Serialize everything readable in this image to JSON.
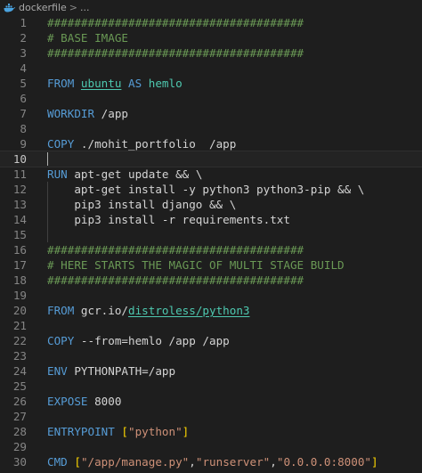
{
  "breadcrumb": {
    "file": "dockerfile",
    "separator": ">",
    "more": "...",
    "file_icon": "docker-whale-icon"
  },
  "editor": {
    "active_line": 10,
    "lines": [
      [
        {
          "t": "######################################",
          "c": "comment"
        }
      ],
      [
        {
          "t": "# BASE IMAGE",
          "c": "comment"
        }
      ],
      [
        {
          "t": "######################################",
          "c": "comment"
        }
      ],
      [],
      [
        {
          "t": "FROM ",
          "c": "keyword"
        },
        {
          "t": "ubuntu",
          "c": "image"
        },
        {
          "t": " AS ",
          "c": "keyword"
        },
        {
          "t": "hemlo",
          "c": "image-plain"
        }
      ],
      [],
      [
        {
          "t": "WORKDIR ",
          "c": "keyword"
        },
        {
          "t": "/app",
          "c": "plain"
        }
      ],
      [],
      [
        {
          "t": "COPY ",
          "c": "keyword"
        },
        {
          "t": "./mohit_portfolio  /app",
          "c": "plain"
        }
      ],
      [],
      [
        {
          "t": "RUN ",
          "c": "keyword"
        },
        {
          "t": "apt-get update && \\",
          "c": "plain"
        }
      ],
      [
        {
          "t": "    apt-get install -y python3 python3-pip && \\",
          "c": "plain"
        }
      ],
      [
        {
          "t": "    pip3 install django && \\",
          "c": "plain"
        }
      ],
      [
        {
          "t": "    pip3 install -r requirements.txt",
          "c": "plain"
        }
      ],
      [],
      [
        {
          "t": "######################################",
          "c": "comment"
        }
      ],
      [
        {
          "t": "# HERE STARTS THE MAGIC OF MULTI STAGE BUILD",
          "c": "comment"
        }
      ],
      [
        {
          "t": "######################################",
          "c": "comment"
        }
      ],
      [],
      [
        {
          "t": "FROM ",
          "c": "keyword"
        },
        {
          "t": "gcr.io/",
          "c": "plain"
        },
        {
          "t": "distroless/python3",
          "c": "image"
        }
      ],
      [],
      [
        {
          "t": "COPY ",
          "c": "keyword"
        },
        {
          "t": "--from=hemlo /app /app",
          "c": "plain"
        }
      ],
      [],
      [
        {
          "t": "ENV ",
          "c": "keyword"
        },
        {
          "t": "PYTHONPATH=/app",
          "c": "plain"
        }
      ],
      [],
      [
        {
          "t": "EXPOSE ",
          "c": "keyword"
        },
        {
          "t": "8000",
          "c": "plain"
        }
      ],
      [],
      [
        {
          "t": "ENTRYPOINT ",
          "c": "keyword"
        },
        {
          "t": "[",
          "c": "bracket"
        },
        {
          "t": "\"python\"",
          "c": "string"
        },
        {
          "t": "]",
          "c": "bracket"
        }
      ],
      [],
      [
        {
          "t": "CMD ",
          "c": "keyword"
        },
        {
          "t": "[",
          "c": "bracket"
        },
        {
          "t": "\"/app/manage.py\"",
          "c": "string"
        },
        {
          "t": ",",
          "c": "plain"
        },
        {
          "t": "\"runserver\"",
          "c": "string"
        },
        {
          "t": ",",
          "c": "plain"
        },
        {
          "t": "\"0.0.0.0:8000\"",
          "c": "string"
        },
        {
          "t": "]",
          "c": "bracket"
        }
      ]
    ]
  },
  "colors": {
    "background": "#1e1e1e",
    "comment": "#6a9955",
    "keyword": "#569cd6",
    "image": "#4ec9b0",
    "string": "#ce9178",
    "bracket": "#ffd700",
    "plain": "#d4d4d4",
    "line_number": "#858585"
  }
}
